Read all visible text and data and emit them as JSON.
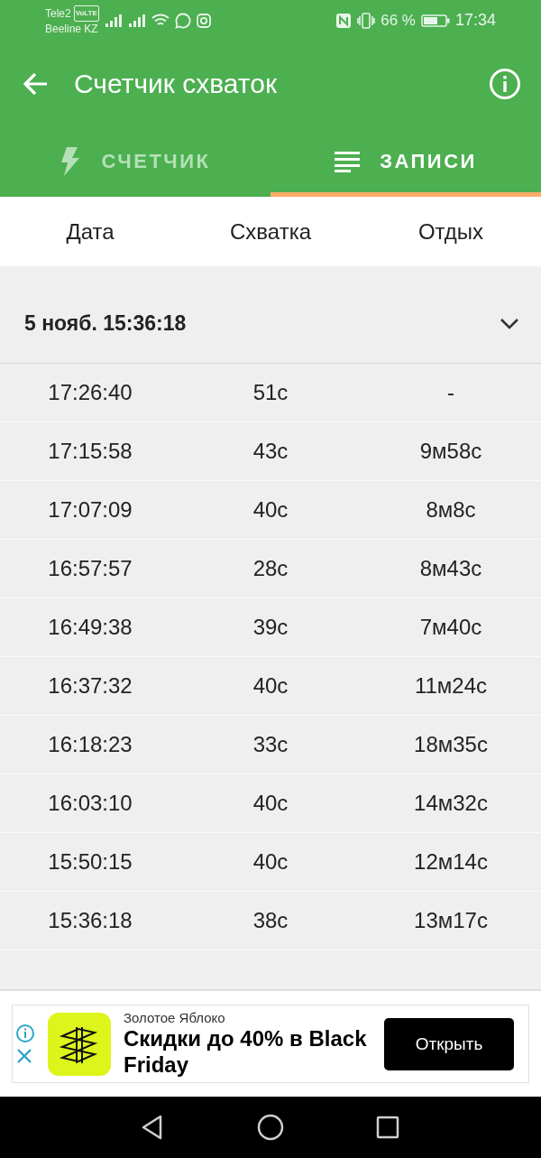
{
  "status_bar": {
    "carriers": [
      "Tele2",
      "Beeline KZ"
    ],
    "volte": "VoLTE",
    "battery_text": "66 %",
    "time": "17:34"
  },
  "app_bar": {
    "title": "Счетчик схваток"
  },
  "tabs": [
    {
      "label": "СЧЕТЧИК",
      "kind": "bolt",
      "selected": false
    },
    {
      "label": "ЗАПИСИ",
      "kind": "list",
      "selected": true
    }
  ],
  "columns": [
    "Дата",
    "Схватка",
    "Отдых"
  ],
  "group": {
    "title": "5 нояб. 15:36:18",
    "expanded": true,
    "rows": [
      [
        "17:26:40",
        "51с",
        "-"
      ],
      [
        "17:15:58",
        "43с",
        "9м58с"
      ],
      [
        "17:07:09",
        "40с",
        "8м8с"
      ],
      [
        "16:57:57",
        "28с",
        "8м43с"
      ],
      [
        "16:49:38",
        "39с",
        "7м40с"
      ],
      [
        "16:37:32",
        "40с",
        "11м24с"
      ],
      [
        "16:18:23",
        "33с",
        "18м35с"
      ],
      [
        "16:03:10",
        "40с",
        "14м32с"
      ],
      [
        "15:50:15",
        "40с",
        "12м14с"
      ],
      [
        "15:36:18",
        "38с",
        "13м17с"
      ]
    ]
  },
  "ad": {
    "advertiser": "Золотое Яблоко",
    "headline": "Скидки до 40% в Black Friday",
    "button": "Открыть"
  }
}
